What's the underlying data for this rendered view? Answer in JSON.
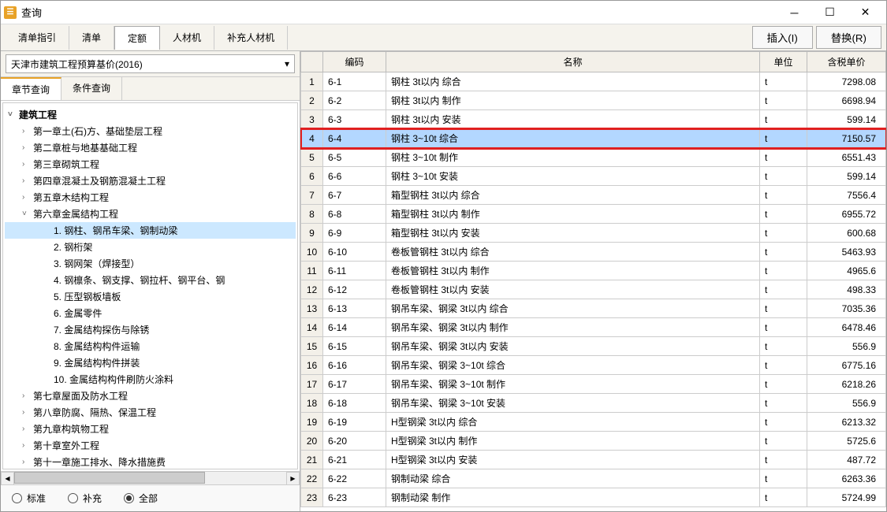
{
  "window": {
    "title": "查询"
  },
  "toolbar": {
    "tabs": [
      "清单指引",
      "清单",
      "定额",
      "人材机",
      "补充人材机"
    ],
    "active_tab": 2,
    "insert_btn": "插入(I)",
    "replace_btn": "替换(R)"
  },
  "left": {
    "dropdown_value": "天津市建筑工程预算基价(2016)",
    "sub_tabs": [
      "章节查询",
      "条件查询"
    ],
    "active_sub_tab": 0,
    "tree": [
      {
        "level": 0,
        "caret": "v",
        "label": "建筑工程",
        "bold": true
      },
      {
        "level": 1,
        "caret": ">",
        "label": "第一章土(石)方、基础垫层工程"
      },
      {
        "level": 1,
        "caret": ">",
        "label": "第二章桩与地基基础工程"
      },
      {
        "level": 1,
        "caret": ">",
        "label": "第三章砌筑工程"
      },
      {
        "level": 1,
        "caret": ">",
        "label": "第四章混凝土及钢筋混凝土工程"
      },
      {
        "level": 1,
        "caret": ">",
        "label": "第五章木结构工程"
      },
      {
        "level": 1,
        "caret": "v",
        "label": "第六章金属结构工程"
      },
      {
        "level": 2,
        "caret": "",
        "label": "1. 钢柱、钢吊车梁、钢制动梁",
        "selected": true
      },
      {
        "level": 2,
        "caret": "",
        "label": "2. 钢桁架"
      },
      {
        "level": 2,
        "caret": "",
        "label": "3. 钢网架（焊接型）"
      },
      {
        "level": 2,
        "caret": "",
        "label": "4. 钢檩条、钢支撑、钢拉杆、钢平台、钢"
      },
      {
        "level": 2,
        "caret": "",
        "label": "5. 压型钢板墙板"
      },
      {
        "level": 2,
        "caret": "",
        "label": "6. 金属零件"
      },
      {
        "level": 2,
        "caret": "",
        "label": "7. 金属结构探伤与除锈"
      },
      {
        "level": 2,
        "caret": "",
        "label": "8. 金属结构构件运输"
      },
      {
        "level": 2,
        "caret": "",
        "label": "9. 金属结构构件拼装"
      },
      {
        "level": 2,
        "caret": "",
        "label": "10. 金属结构构件刷防火涂料"
      },
      {
        "level": 1,
        "caret": ">",
        "label": "第七章屋面及防水工程"
      },
      {
        "level": 1,
        "caret": ">",
        "label": "第八章防腐、隔热、保温工程"
      },
      {
        "level": 1,
        "caret": ">",
        "label": "第九章构筑物工程"
      },
      {
        "level": 1,
        "caret": ">",
        "label": "第十章室外工程"
      },
      {
        "level": 1,
        "caret": ">",
        "label": "第十一章施工排水、降水措施费"
      }
    ],
    "radios": [
      "标准",
      "补充",
      "全部"
    ],
    "radio_selected": 2
  },
  "grid": {
    "headers": {
      "code": "编码",
      "name": "名称",
      "unit": "单位",
      "price": "含税单价"
    },
    "rows": [
      {
        "n": 1,
        "code": "6-1",
        "name": "钢柱 3t以内 综合",
        "unit": "t",
        "price": "7298.08"
      },
      {
        "n": 2,
        "code": "6-2",
        "name": "钢柱 3t以内 制作",
        "unit": "t",
        "price": "6698.94"
      },
      {
        "n": 3,
        "code": "6-3",
        "name": "钢柱 3t以内 安装",
        "unit": "t",
        "price": "599.14"
      },
      {
        "n": 4,
        "code": "6-4",
        "name": "钢柱 3~10t 综合",
        "unit": "t",
        "price": "7150.57",
        "highlighted": true
      },
      {
        "n": 5,
        "code": "6-5",
        "name": "钢柱 3~10t 制作",
        "unit": "t",
        "price": "6551.43"
      },
      {
        "n": 6,
        "code": "6-6",
        "name": "钢柱 3~10t 安装",
        "unit": "t",
        "price": "599.14"
      },
      {
        "n": 7,
        "code": "6-7",
        "name": "箱型钢柱 3t以内 综合",
        "unit": "t",
        "price": "7556.4"
      },
      {
        "n": 8,
        "code": "6-8",
        "name": "箱型钢柱 3t以内 制作",
        "unit": "t",
        "price": "6955.72"
      },
      {
        "n": 9,
        "code": "6-9",
        "name": "箱型钢柱 3t以内 安装",
        "unit": "t",
        "price": "600.68"
      },
      {
        "n": 10,
        "code": "6-10",
        "name": "卷板管钢柱 3t以内 综合",
        "unit": "t",
        "price": "5463.93"
      },
      {
        "n": 11,
        "code": "6-11",
        "name": "卷板管钢柱 3t以内 制作",
        "unit": "t",
        "price": "4965.6"
      },
      {
        "n": 12,
        "code": "6-12",
        "name": "卷板管钢柱 3t以内 安装",
        "unit": "t",
        "price": "498.33"
      },
      {
        "n": 13,
        "code": "6-13",
        "name": "钢吊车梁、钢梁 3t以内 综合",
        "unit": "t",
        "price": "7035.36"
      },
      {
        "n": 14,
        "code": "6-14",
        "name": "钢吊车梁、钢梁 3t以内 制作",
        "unit": "t",
        "price": "6478.46"
      },
      {
        "n": 15,
        "code": "6-15",
        "name": "钢吊车梁、钢梁 3t以内 安装",
        "unit": "t",
        "price": "556.9"
      },
      {
        "n": 16,
        "code": "6-16",
        "name": "钢吊车梁、钢梁 3~10t 综合",
        "unit": "t",
        "price": "6775.16"
      },
      {
        "n": 17,
        "code": "6-17",
        "name": "钢吊车梁、钢梁 3~10t 制作",
        "unit": "t",
        "price": "6218.26"
      },
      {
        "n": 18,
        "code": "6-18",
        "name": "钢吊车梁、钢梁 3~10t 安装",
        "unit": "t",
        "price": "556.9"
      },
      {
        "n": 19,
        "code": "6-19",
        "name": "H型钢梁 3t以内 综合",
        "unit": "t",
        "price": "6213.32"
      },
      {
        "n": 20,
        "code": "6-20",
        "name": "H型钢梁 3t以内 制作",
        "unit": "t",
        "price": "5725.6"
      },
      {
        "n": 21,
        "code": "6-21",
        "name": "H型钢梁 3t以内 安装",
        "unit": "t",
        "price": "487.72"
      },
      {
        "n": 22,
        "code": "6-22",
        "name": "钢制动梁 综合",
        "unit": "t",
        "price": "6263.36"
      },
      {
        "n": 23,
        "code": "6-23",
        "name": "钢制动梁 制作",
        "unit": "t",
        "price": "5724.99"
      }
    ]
  }
}
